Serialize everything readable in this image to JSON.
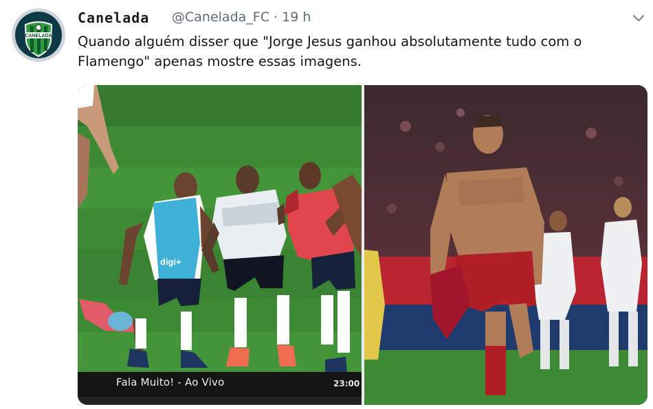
{
  "tweet": {
    "display_name": "Canelada",
    "handle": "@Canelada_FC",
    "separator": "·",
    "time": "19 h",
    "text": "Quando alguém disser que \"Jorge Jesus ganhou absolutamente tudo com o Flamengo\" apenas mostre essas imagens."
  },
  "avatar": {
    "logo_text": "CANELADA",
    "colors": {
      "outer": "#cfd5da",
      "ring": "#0c3b45",
      "shield_green": "#2e9b3e",
      "stripe": "#0c5a2b"
    }
  },
  "media": {
    "left_image": {
      "broadcast_label": "Fala Muito! - Ao Vivo",
      "clock": "23:00",
      "shirt_text": "digi+"
    },
    "right_image": {}
  },
  "icons": {
    "more": "chevron-down-icon"
  },
  "colors": {
    "handle": "#5f6d78",
    "text": "#14171a",
    "pitch": "#3f8f36"
  }
}
